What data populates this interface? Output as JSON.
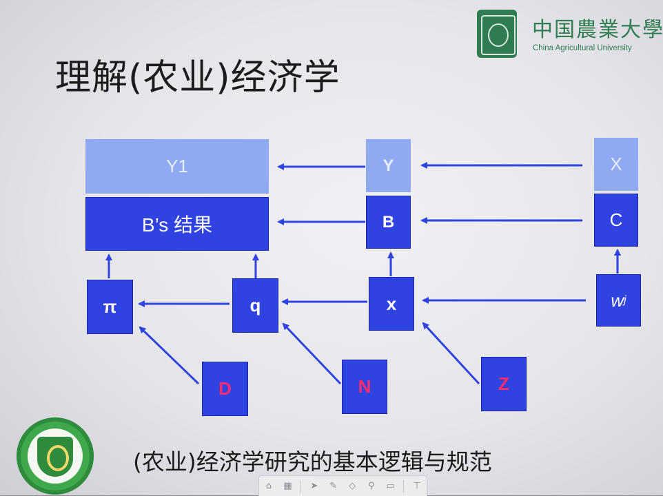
{
  "slide": {
    "title": "理解(农业)经济学",
    "caption": "(农业)经济学研究的基本逻辑与规范"
  },
  "logo": {
    "name_cn": "中国農業大學",
    "name_en": "China Agricultural University"
  },
  "diagram": {
    "nodes": {
      "y1": "Y1",
      "b_result": "B’s 结果",
      "Y": "Y",
      "X": "X",
      "B": "B",
      "C": "C",
      "pi": "π",
      "q": "q",
      "x": "x",
      "wj": "w",
      "wj_sub": "j",
      "D": "D",
      "N": "N",
      "Z": "Z"
    },
    "colors": {
      "light_box": "#8fa9f2",
      "dark_box": "#2f43e0",
      "arrow": "#2f43e0",
      "red_label": "#ff2a6e"
    },
    "edges": [
      {
        "from": "Y",
        "to": "y1"
      },
      {
        "from": "X",
        "to": "Y"
      },
      {
        "from": "B",
        "to": "b_result"
      },
      {
        "from": "C",
        "to": "B"
      },
      {
        "from": "pi",
        "to": "b_result"
      },
      {
        "from": "q",
        "to": "b_result"
      },
      {
        "from": "x",
        "to": "B"
      },
      {
        "from": "wj",
        "to": "C"
      },
      {
        "from": "q",
        "to": "pi"
      },
      {
        "from": "x",
        "to": "q"
      },
      {
        "from": "wj",
        "to": "x"
      },
      {
        "from": "D",
        "to": "pi"
      },
      {
        "from": "N",
        "to": "q"
      },
      {
        "from": "Z",
        "to": "x"
      }
    ]
  },
  "toolbar": {
    "icons": [
      "home-icon",
      "grid-icon",
      "pointer-icon",
      "pen-icon",
      "eraser-icon",
      "zoom-icon",
      "screen-icon",
      "pin-icon"
    ]
  }
}
